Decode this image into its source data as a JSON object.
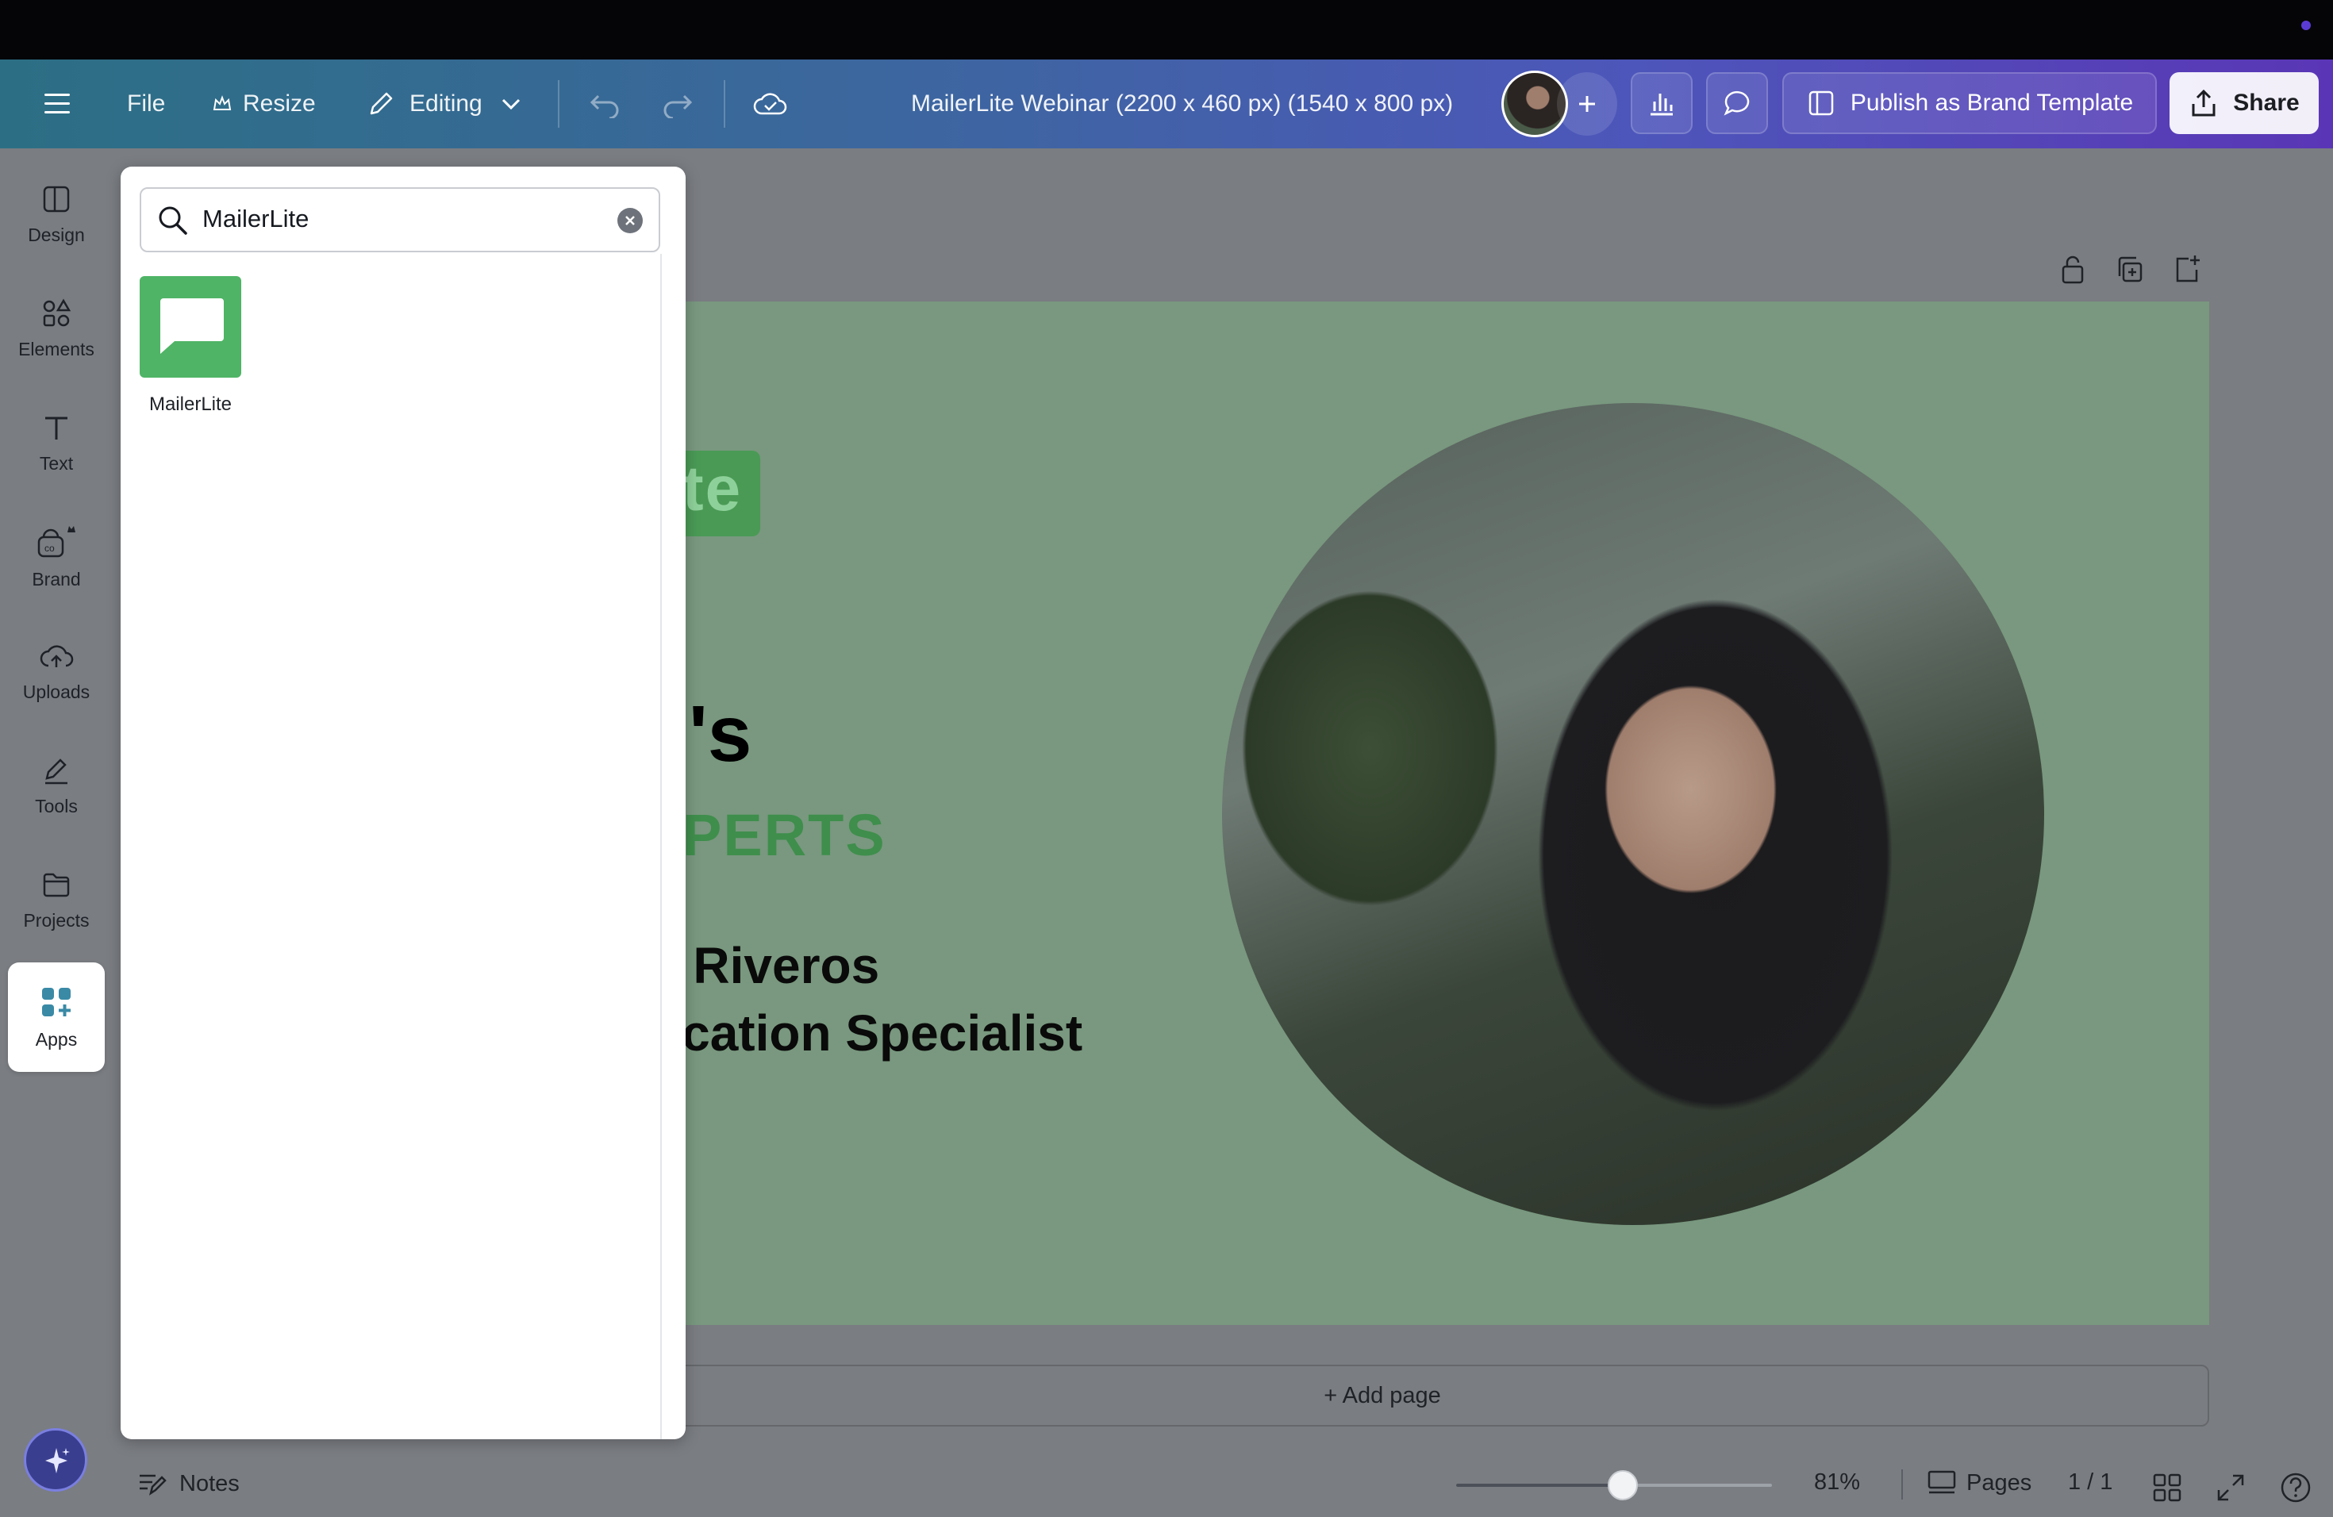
{
  "header": {
    "file_label": "File",
    "resize_label": "Resize",
    "editing_label": "Editing",
    "doc_title": "MailerLite Webinar (2200 x 460 px) (1540 x 800 px)",
    "publish_label": "Publish as Brand Template",
    "share_label": "Share"
  },
  "sidebar": {
    "items": [
      {
        "label": "Design",
        "icon": "design-icon"
      },
      {
        "label": "Elements",
        "icon": "elements-icon"
      },
      {
        "label": "Text",
        "icon": "text-icon"
      },
      {
        "label": "Brand",
        "icon": "brand-icon"
      },
      {
        "label": "Uploads",
        "icon": "uploads-icon"
      },
      {
        "label": "Tools",
        "icon": "tools-icon"
      },
      {
        "label": "Projects",
        "icon": "projects-icon"
      },
      {
        "label": "Apps",
        "icon": "apps-icon"
      }
    ]
  },
  "panel": {
    "search_value": "MailerLite",
    "results": [
      {
        "label": "MailerLite",
        "icon": "chat-bubble-icon"
      }
    ]
  },
  "canvas": {
    "logo_fragment": "te",
    "title_fragment": "'s",
    "subtitle_fragment": "PERTS",
    "name_fragment": "y Riveros",
    "role_fragment": "ucation Specialist"
  },
  "footer": {
    "add_page_label": "+ Add page",
    "notes_label": "Notes",
    "zoom": "81%",
    "pages_label": "Pages",
    "page_count": "1 / 1"
  },
  "colors": {
    "brand_green": "#4fb466",
    "page_bg": "#79987f",
    "header_start": "#2c6f84",
    "header_end": "#5a36b6"
  }
}
